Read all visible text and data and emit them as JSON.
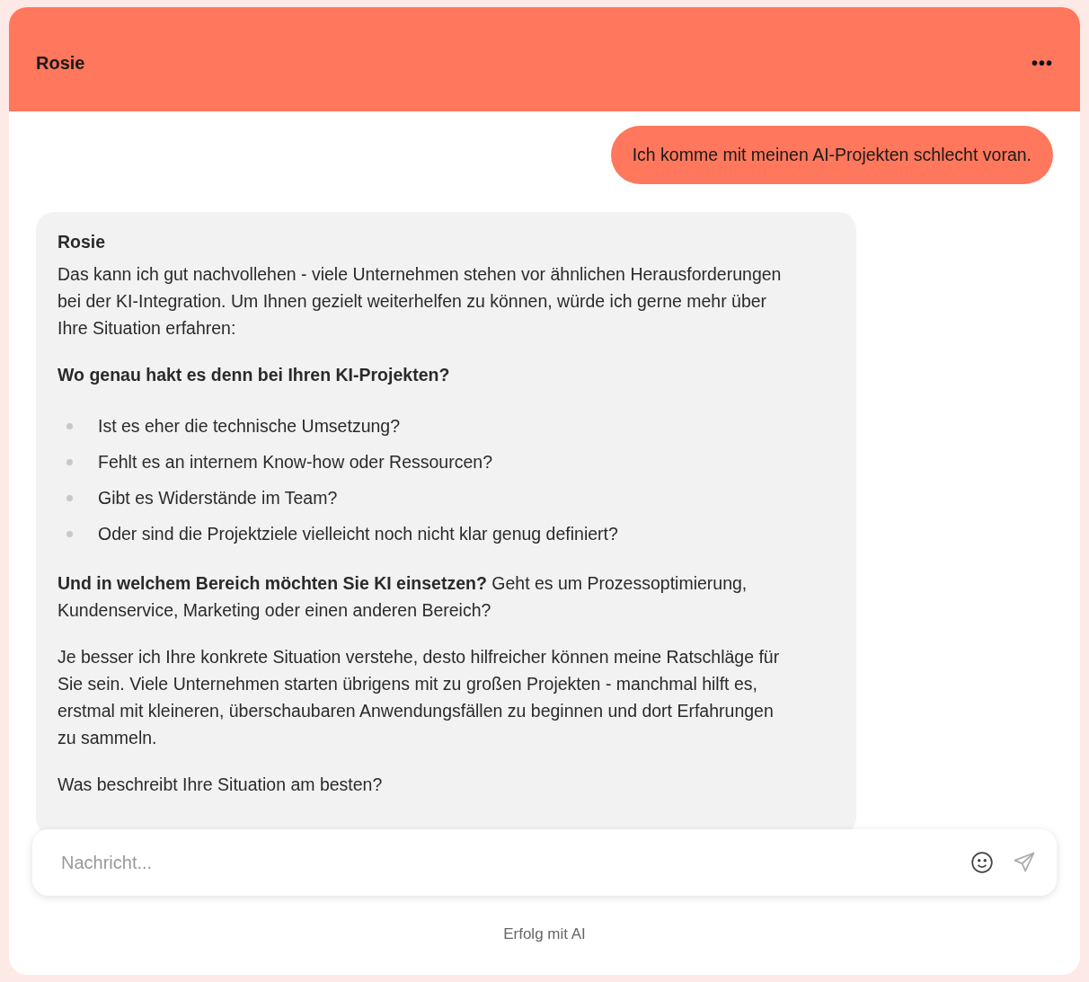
{
  "header": {
    "title": "Rosie",
    "menu_icon": "•••"
  },
  "messages": [
    {
      "kind": "user",
      "text": "Ich komme mit meinen AI-Projekten schlecht voran."
    },
    {
      "kind": "bot",
      "sender": "Rosie",
      "blocks": [
        {
          "kind": "paragraph",
          "text": "Das kann ich gut nachvollehen - viele Unternehmen stehen vor ähnlichen Herausforderungen bei der KI-Integration. Um Ihnen gezielt weiterhelfen zu können, würde ich gerne mehr über Ihre Situation erfahren:"
        },
        {
          "kind": "heading",
          "text": "Wo genau hakt es denn bei Ihren KI-Projekten?"
        },
        {
          "kind": "list",
          "items": [
            "Ist es eher die technische Umsetzung?",
            "Fehlt es an internem Know-how oder Ressourcen?",
            "Gibt es Widerstände im Team?",
            "Oder sind die Projektziele vielleicht noch nicht klar genug definiert?"
          ]
        },
        {
          "kind": "paragraph",
          "text": "**Und in welchem Bereich möchten Sie KI einsetzen?** Geht es um Prozessoptimierung, Kundenservice, Marketing oder einen anderen Bereich?"
        },
        {
          "kind": "paragraph",
          "text": "Je besser ich Ihre konkrete Situation verstehe, desto hilfreicher können meine Ratschläge für Sie sein. Viele Unternehmen starten übrigens mit zu großen Projekten - manchmal hilft es, erstmal mit kleineren, überschaubaren Anwendungsfällen zu beginnen und dort Erfahrungen zu sammeln."
        },
        {
          "kind": "paragraph",
          "text": "Was beschreibt Ihre Situation am besten?"
        }
      ]
    }
  ],
  "input": {
    "placeholder": "Nachricht..."
  },
  "footer": "Erfolg mit AI"
}
